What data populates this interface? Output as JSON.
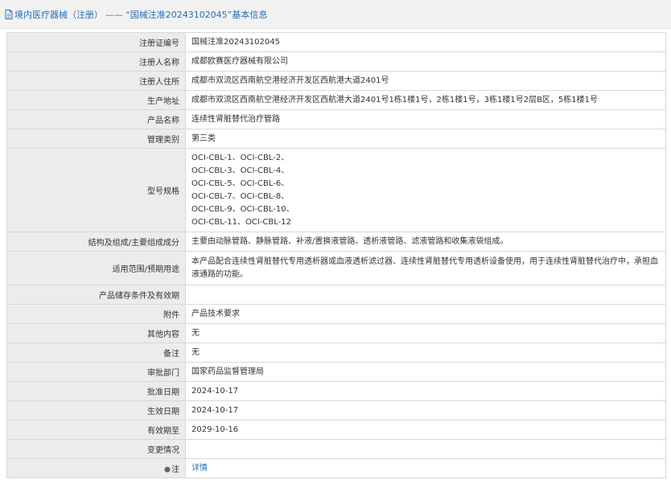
{
  "header": {
    "section": "境内医疗器械（注册）",
    "separator": "——",
    "title": "“国械注准20243102045”基本信息"
  },
  "rows": {
    "reg_no": {
      "label": "注册证编号",
      "value": "国械注准20243102045"
    },
    "registrant": {
      "label": "注册人名称",
      "value": "成都欧赛医疗器械有限公司"
    },
    "registrant_addr": {
      "label": "注册人住所",
      "value": "成都市双流区西南航空港经济开发区西航港大道2401号"
    },
    "production_addr": {
      "label": "生产地址",
      "value": "成都市双流区西南航空港经济开发区西航港大道2401号1栋1楼1号，2栋1楼1号，3栋1楼1号2层B区，5栋1楼1号"
    },
    "product_name": {
      "label": "产品名称",
      "value": "连续性肾脏替代治疗管路"
    },
    "category": {
      "label": "管理类别",
      "value": "第三类"
    },
    "models": {
      "label": "型号规格",
      "lines": [
        "OCI-CBL-1、OCI-CBL-2、",
        "OCI-CBL-3、OCI-CBL-4、",
        "OCI-CBL-5、OCI-CBL-6、",
        "OCI-CBL-7、OCI-CBL-8、",
        "OCI-CBL-9、OCI-CBL-10、",
        "OCI-CBL-11、OCI-CBL-12"
      ]
    },
    "structure": {
      "label": "结构及组成/主要组成成分",
      "value": "主要由动脉管路、静脉管路、补液/置换液管路、透析液管路、滤液管路和收集液袋组成。"
    },
    "intended_use": {
      "label": "适用范围/预期用途",
      "value": "本产品配合连续性肾脏替代专用透析器或血液透析滤过器、连续性肾脏替代专用透析设备使用，用于连续性肾脏替代治疗中，承担血液通路的功能。"
    },
    "storage": {
      "label": "产品储存条件及有效期",
      "value": ""
    },
    "attachment": {
      "label": "附件",
      "value": "产品技术要求"
    },
    "other": {
      "label": "其他内容",
      "value": "无"
    },
    "remark": {
      "label": "备注",
      "value": "无"
    },
    "approval_dept": {
      "label": "审批部门",
      "value": "国家药品监督管理局"
    },
    "approval_date": {
      "label": "批准日期",
      "value": "2024-10-17"
    },
    "effective_date": {
      "label": "生效日期",
      "value": "2024-10-17"
    },
    "valid_until": {
      "label": "有效期至",
      "value": "2029-10-16"
    },
    "changes": {
      "label": "变更情况",
      "value": ""
    },
    "note": {
      "label": "注",
      "link_text": "详情"
    }
  }
}
